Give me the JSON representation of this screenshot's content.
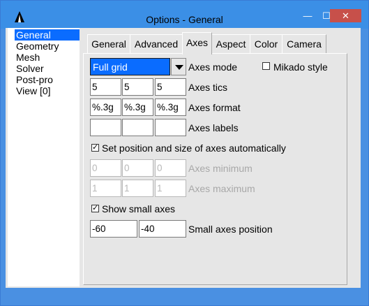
{
  "window": {
    "title": "Options - General",
    "minimize_glyph": "—",
    "maximize_glyph": "☐",
    "close_glyph": "✕"
  },
  "nav": {
    "items": [
      "General",
      "Geometry",
      "Mesh",
      "Solver",
      "Post-pro",
      "View [0]"
    ],
    "selected_index": 0
  },
  "tabs": {
    "items": [
      "General",
      "Advanced",
      "Axes",
      "Aspect",
      "Color",
      "Camera"
    ],
    "active": "Axes"
  },
  "axes": {
    "mode_value": "Full grid",
    "mode_label": "Axes mode",
    "mikado_label": "Mikado style",
    "tics": [
      "5",
      "5",
      "5"
    ],
    "tics_label": "Axes tics",
    "format": [
      "%.3g",
      "%.3g",
      "%.3g"
    ],
    "format_label": "Axes format",
    "labels": [
      "",
      "",
      ""
    ],
    "labels_label": "Axes labels",
    "auto_label": "Set position and size of axes automatically",
    "minimum": [
      "0",
      "0",
      "0"
    ],
    "minimum_label": "Axes minimum",
    "maximum": [
      "1",
      "1",
      "1"
    ],
    "maximum_label": "Axes maximum",
    "small_axes_label": "Show small axes",
    "small_pos": [
      "-60",
      "-40"
    ],
    "small_pos_label": "Small axes position",
    "check_glyph": "✓"
  }
}
